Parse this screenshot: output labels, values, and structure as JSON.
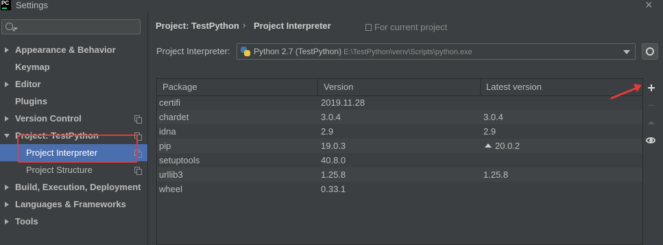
{
  "window": {
    "title": "Settings",
    "app_icon_text": "PC"
  },
  "search": {
    "placeholder": ""
  },
  "sidebar": {
    "items": [
      {
        "label": "Appearance & Behavior",
        "expandable": true
      },
      {
        "label": "Keymap",
        "expandable": false
      },
      {
        "label": "Editor",
        "expandable": true
      },
      {
        "label": "Plugins",
        "expandable": false
      },
      {
        "label": "Version Control",
        "expandable": true
      },
      {
        "label": "Project: TestPython",
        "expanded": true
      },
      {
        "label": "Project Interpreter",
        "selected": true
      },
      {
        "label": "Project Structure"
      },
      {
        "label": "Build, Execution, Deployment",
        "expandable": true
      },
      {
        "label": "Languages & Frameworks",
        "expandable": true
      },
      {
        "label": "Tools",
        "expandable": true
      }
    ]
  },
  "breadcrumb": {
    "project": "Project: TestPython",
    "separator": "›",
    "page": "Project Interpreter",
    "scope_note": "For current project"
  },
  "interpreter": {
    "label": "Project Interpreter:",
    "name": "Python 2.7 (TestPython)",
    "path": "E:\\TestPython\\venv\\Scripts\\python.exe"
  },
  "packages": {
    "columns": [
      "Package",
      "Version",
      "Latest version"
    ],
    "rows": [
      {
        "package": "certifi",
        "version": "2019.11.28",
        "latest": ""
      },
      {
        "package": "chardet",
        "version": "3.0.4",
        "latest": "3.0.4"
      },
      {
        "package": "idna",
        "version": "2.9",
        "latest": "2.9"
      },
      {
        "package": "pip",
        "version": "19.0.3",
        "latest": "20.0.2",
        "upgrade": true
      },
      {
        "package": "setuptools",
        "version": "40.8.0",
        "latest": ""
      },
      {
        "package": "urllib3",
        "version": "1.25.8",
        "latest": "1.25.8"
      },
      {
        "package": "wheel",
        "version": "0.33.1",
        "latest": ""
      }
    ]
  },
  "toolbar": {
    "add_icon": "plus-icon",
    "remove_icon": "minus-icon",
    "upgrade_icon": "up-arrow-icon",
    "show_early_icon": "eye-icon"
  },
  "colors": {
    "selection": "#4b6eaf",
    "annotation": "#e23c3c",
    "background": "#3c3f41"
  }
}
